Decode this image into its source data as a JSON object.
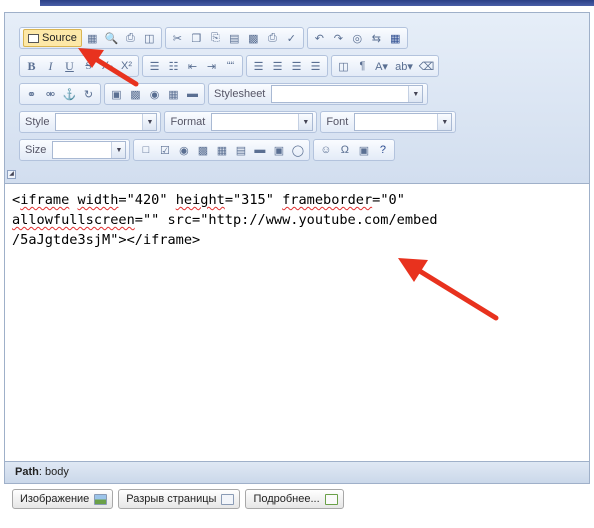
{
  "toolbar": {
    "source_label": "Source",
    "stylesheet_label": "Stylesheet",
    "style_label": "Style",
    "format_label": "Format",
    "font_label": "Font",
    "size_label": "Size",
    "symbols": {
      "bold": "B",
      "italic": "I",
      "underline": "U",
      "strike": "S",
      "subscript": "X₂",
      "superscript": "X²",
      "omega": "Ω",
      "help": "?",
      "blockquote": "““"
    }
  },
  "editor": {
    "source_lines": [
      {
        "parts": [
          "<",
          "iframe",
          " ",
          "width",
          "=\"420\" ",
          "height",
          "=\"315\" ",
          "frameborder",
          "=\"0\""
        ]
      },
      {
        "parts": [
          "allowfullscreen",
          "=\"\" src=\"http://www.youtube.com/embed"
        ]
      },
      {
        "parts": [
          "/5aJgtde3sjM\"></iframe>"
        ]
      }
    ]
  },
  "pathbar": {
    "label": "Path",
    "value": "body"
  },
  "bottom_buttons": [
    {
      "label": "Изображение"
    },
    {
      "label": "Разрыв страницы"
    },
    {
      "label": "Подробнее..."
    }
  ],
  "colors": {
    "arrow": "#e8321e",
    "toolbar_bg": "#dbe5f3",
    "source_highlight": "#fde8a8"
  }
}
